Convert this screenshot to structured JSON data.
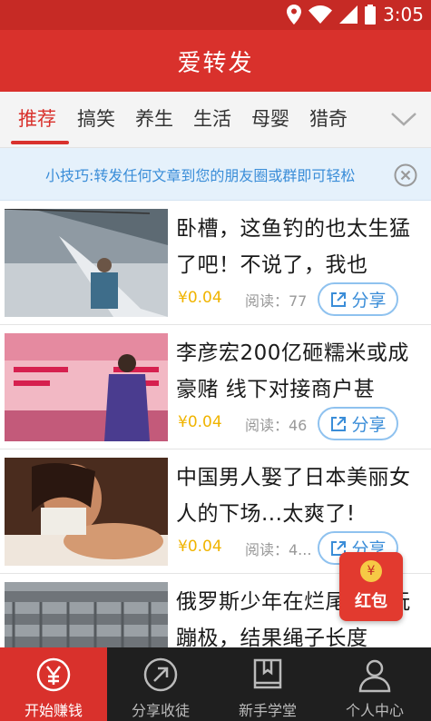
{
  "status_bar": {
    "time": "3:05",
    "icons": [
      "location-icon",
      "wifi-icon",
      "signal-icon",
      "battery-icon"
    ]
  },
  "app": {
    "title": "爱转发",
    "accent_color": "#d9312c"
  },
  "tabs": [
    {
      "label": "推荐",
      "active": true
    },
    {
      "label": "搞笑",
      "active": false
    },
    {
      "label": "养生",
      "active": false
    },
    {
      "label": "生活",
      "active": false
    },
    {
      "label": "母婴",
      "active": false
    },
    {
      "label": "猎奇",
      "active": false
    }
  ],
  "tip": {
    "text": "小技巧:转发任何文章到您的朋友圈或群即可轻松"
  },
  "articles": [
    {
      "title": "卧槽，这鱼钓的也太生猛了吧！不说了，我也",
      "price": "¥0.04",
      "reads": "阅读：77",
      "share_label": "分享"
    },
    {
      "title": "李彦宏200亿砸糯米或成豪赌 线下对接商户甚",
      "price": "¥0.04",
      "reads": "阅读：46",
      "share_label": "分享"
    },
    {
      "title": "中国男人娶了日本美丽女人的下场...太爽了!",
      "price": "¥0.04",
      "reads": "阅读：4...",
      "share_label": "分享"
    },
    {
      "title": "俄罗斯少年在烂尾楼顶玩蹦极，结果绳子长度",
      "price": "",
      "reads": "",
      "share_label": ""
    }
  ],
  "red_packet": {
    "label": "红包",
    "coin": "¥"
  },
  "bottom_nav": [
    {
      "label": "开始赚钱",
      "icon": "yen-icon",
      "active": true
    },
    {
      "label": "分享收徒",
      "icon": "share-arrow-icon",
      "active": false
    },
    {
      "label": "新手学堂",
      "icon": "book-icon",
      "active": false
    },
    {
      "label": "个人中心",
      "icon": "person-icon",
      "active": false
    }
  ]
}
